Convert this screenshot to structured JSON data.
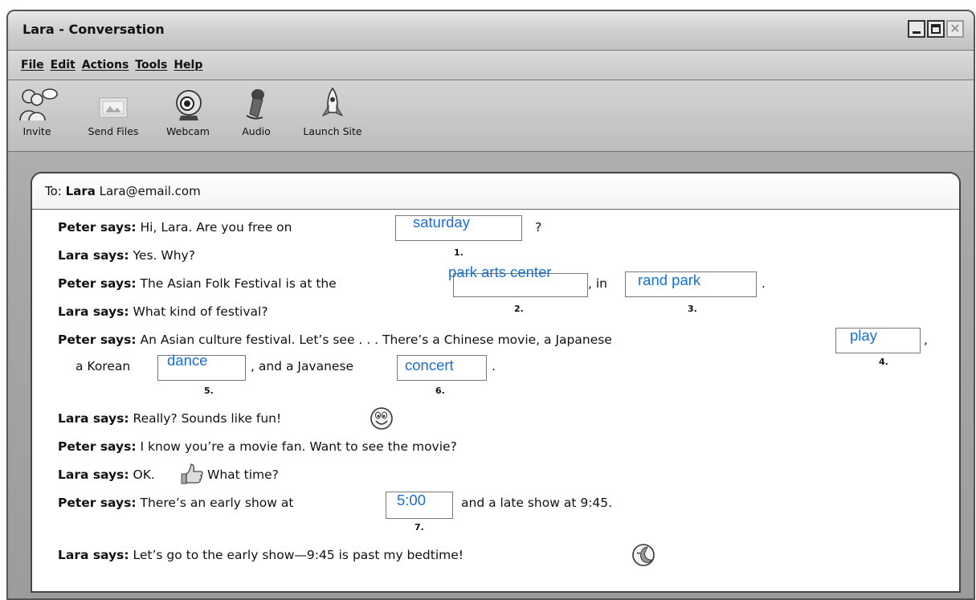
{
  "window": {
    "title": "Lara - Conversation",
    "close_glyph": "✕"
  },
  "menu": {
    "file": "File",
    "edit": "Edit",
    "actions": "Actions",
    "tools": "Tools",
    "help": "Help"
  },
  "toolbar": {
    "invite": "Invite",
    "send_files": "Send Files",
    "webcam": "Webcam",
    "audio": "Audio",
    "launch_site": "Launch Site"
  },
  "header": {
    "to_label": "To:",
    "to_name": "Lara",
    "to_email": "Lara@email.com"
  },
  "conversation": {
    "l1_speaker": "Peter says:",
    "l1_text": "Hi, Lara.  Are you free on",
    "l1_end": "?",
    "l2_speaker": "Lara says:",
    "l2_text": "Yes. Why?",
    "l3_speaker": "Peter says:",
    "l3_text": "The Asian Folk Festival is at the",
    "l3_mid": ", in",
    "l3_end": ".",
    "l4_speaker": "Lara says:",
    "l4_text": "What kind of festival?",
    "l5_speaker": "Peter says:",
    "l5_text": "An Asian culture festival.  Let’s see . . .  There’s a Chinese movie, a Japanese",
    "l5_end": ",",
    "l6_text": "a Korean",
    "l6_mid": ", and a Javanese",
    "l6_end": ".",
    "l7_speaker": "Lara says:",
    "l7_text": "Really? Sounds like fun!",
    "l8_speaker": "Peter says:",
    "l8_text": "I know you’re a movie fan.  Want to see the movie?",
    "l9_speaker": "Lara says:",
    "l9_text": "OK.",
    "l9_text2": "What time?",
    "l10_speaker": "Peter says:",
    "l10_text": "There’s an early show at",
    "l10_end": "and a late show at 9:45.",
    "l11_speaker": "Lara says:",
    "l11_text": "Let’s go to the early show—9:45 is past my bedtime!"
  },
  "answers": {
    "a1": "saturday",
    "a2": "park arts center",
    "a3": "rand park",
    "a4": "play",
    "a5": "dance",
    "a6": "concert",
    "a7": "5:00"
  },
  "numbers": {
    "n1": "1.",
    "n2": "2.",
    "n3": "3.",
    "n4": "4.",
    "n5": "5.",
    "n6": "6.",
    "n7": "7."
  },
  "colors": {
    "answer": "#1a6fd0"
  },
  "icons": {
    "invite": "people-icon",
    "send_files": "files-icon",
    "webcam": "webcam-icon",
    "audio": "microphone-icon",
    "launch_site": "rocket-icon",
    "smile": "smiley-icon",
    "thumb": "thumbs-up-icon",
    "sleep": "sleepy-moon-icon"
  }
}
